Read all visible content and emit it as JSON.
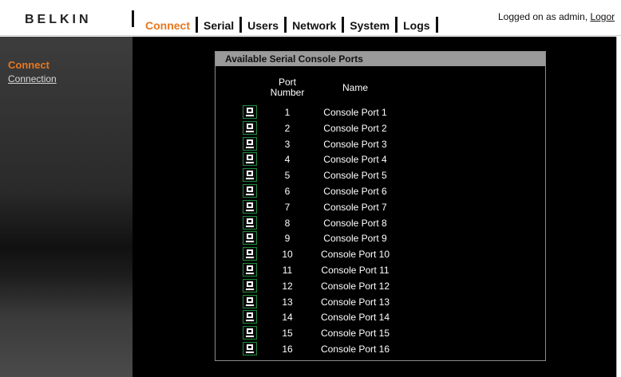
{
  "header": {
    "logo": "BELKIN",
    "nav": [
      {
        "label": "Connect",
        "active": true
      },
      {
        "label": "Serial",
        "active": false
      },
      {
        "label": "Users",
        "active": false
      },
      {
        "label": "Network",
        "active": false
      },
      {
        "label": "System",
        "active": false
      },
      {
        "label": "Logs",
        "active": false
      }
    ],
    "login_text": "Logged on as admin,",
    "logout_label": "Logor"
  },
  "sidebar": {
    "title": "Connect",
    "items": [
      {
        "label": "Connection"
      }
    ]
  },
  "panel": {
    "title": "Available Serial Console Ports",
    "col_port": "Port Number",
    "col_name": "Name",
    "rows": [
      {
        "num": "1",
        "name": "Console Port 1"
      },
      {
        "num": "2",
        "name": "Console Port 2"
      },
      {
        "num": "3",
        "name": "Console Port 3"
      },
      {
        "num": "4",
        "name": "Console Port 4"
      },
      {
        "num": "5",
        "name": "Console Port 5"
      },
      {
        "num": "6",
        "name": "Console Port 6"
      },
      {
        "num": "7",
        "name": "Console Port 7"
      },
      {
        "num": "8",
        "name": "Console Port 8"
      },
      {
        "num": "9",
        "name": "Console Port 9"
      },
      {
        "num": "10",
        "name": "Console Port 10"
      },
      {
        "num": "11",
        "name": "Console Port 11"
      },
      {
        "num": "12",
        "name": "Console Port 12"
      },
      {
        "num": "13",
        "name": "Console Port 13"
      },
      {
        "num": "14",
        "name": "Console Port 14"
      },
      {
        "num": "15",
        "name": "Console Port 15"
      },
      {
        "num": "16",
        "name": "Console Port 16"
      }
    ]
  },
  "colors": {
    "accent": "#e8771f",
    "icon_border": "#1d8a3a",
    "panel_header": "#9a9a9a",
    "main_bg": "#000000"
  },
  "icons": {
    "port": "terminal-icon"
  }
}
